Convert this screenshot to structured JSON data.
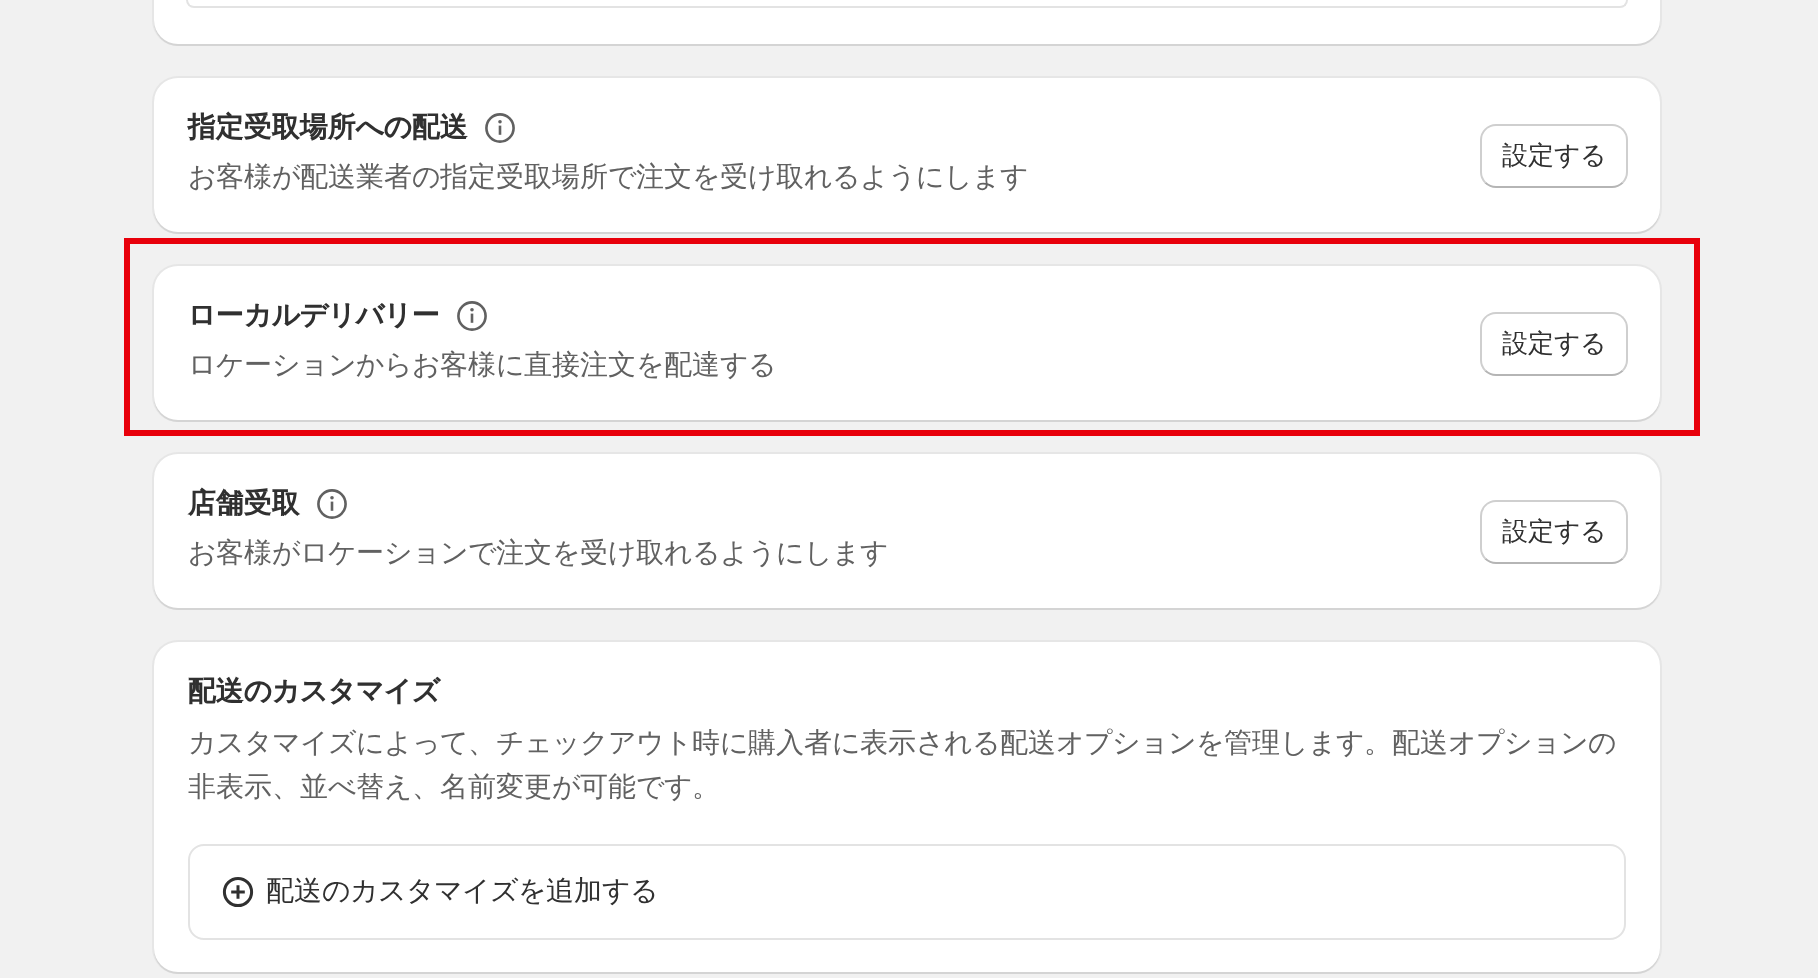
{
  "cards": [
    {
      "kind": "option",
      "title": "指定受取場所への配送",
      "description": "お客様が配送業者の指定受取場所で注文を受け取れるようにします",
      "button": "設定する",
      "highlighted": false
    },
    {
      "kind": "option",
      "title": "ローカルデリバリー",
      "description": "ロケーションからお客様に直接注文を配達する",
      "button": "設定する",
      "highlighted": true
    },
    {
      "kind": "option",
      "title": "店舗受取",
      "description": "お客様がロケーションで注文を受け取れるようにします",
      "button": "設定する",
      "highlighted": false
    },
    {
      "kind": "custom",
      "title": "配送のカスタマイズ",
      "description": "カスタマイズによって、チェックアウト時に購入者に表示される配送オプションを管理します。配送オプションの非表示、並べ替え、名前変更が可能です。",
      "button": "配送のカスタマイズを追加する",
      "highlighted": false
    }
  ]
}
